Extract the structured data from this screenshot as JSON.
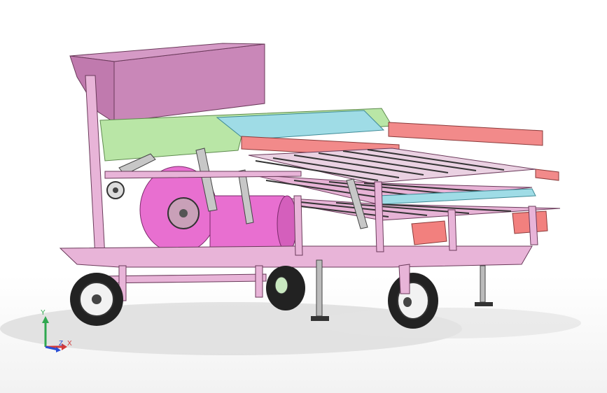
{
  "viewport": {
    "background": "#ffffff",
    "shadow_color": "#d6d6d6"
  },
  "model": {
    "frame_color": "#e8b4d8",
    "frame_edge_color": "#6a3a5a",
    "hopper_color": "#c987b8",
    "sieve_green_color": "#b9e6a6",
    "sieve_cyan_color": "#9fdce6",
    "rail_red_color": "#f28a8a",
    "fan_color": "#e86fd0",
    "tray_color": "#e7b3d6",
    "wheel_color": "#222222",
    "hub_color": "#f2f2f2"
  },
  "triad": {
    "x_label": "X",
    "y_label": "Y",
    "z_label": "Z",
    "x_color": "#d23a3a",
    "y_color": "#2fa84f",
    "z_color": "#2a4fd6"
  }
}
